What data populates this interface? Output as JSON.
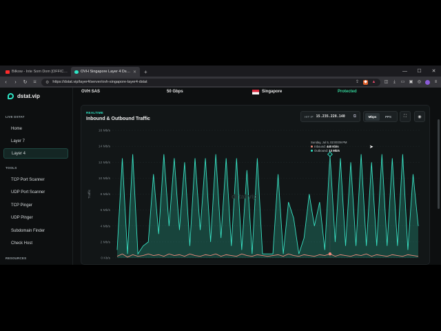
{
  "browser": {
    "tabs": [
      {
        "title": "Bilkow - Inte Som Dom [OFFICIAL...",
        "active": false,
        "favicon_color": "#ff2b2b"
      },
      {
        "title": "OVH Singapore Layer 4 Dstat Gr...",
        "active": true,
        "favicon_color": "#2ee6c6"
      }
    ],
    "new_tab": "+",
    "url": "https://dstat.vip/layer4/server/ovh-singapore-layer4-dstat"
  },
  "sidebar": {
    "logo": "dstat.vip",
    "sections": [
      {
        "title": "LIVE DSTAT",
        "items": [
          "Home",
          "Layer 7",
          "Layer 4"
        ]
      },
      {
        "title": "TOOLS",
        "items": [
          "TCP Port Scanner",
          "UDP Port Scanner",
          "TCP Pinger",
          "UDP Pinger",
          "Subdomain Finder",
          "Check Host"
        ]
      },
      {
        "title": "RESOURCES",
        "items": []
      }
    ],
    "active_item": "Layer 4"
  },
  "info": {
    "provider": "OVH SAS",
    "capacity": "50 Gbps",
    "location": "Singapore",
    "status": "Protected"
  },
  "card": {
    "eyebrow": "REALTIME",
    "title": "Inbound & Outbound Traffic",
    "hit_ip_label": "HIT IP",
    "hit_ip": "15.235.228.140",
    "toggle": [
      "Mbps",
      "PPS"
    ],
    "active_toggle": "Mbps",
    "watermark": "dstat.vip"
  },
  "tooltip": {
    "time": "Sunday, Jul 5, 02:00:09 PM",
    "inbound_label": "Inbound:",
    "inbound_value": "440 Kb/s",
    "outbound_label": "Outbound:",
    "outbound_value": "13 Mb/s"
  },
  "colors": {
    "accent": "#2ee6c6",
    "inbound": "#f08a7c",
    "background": "#0d0f10"
  },
  "chart_data": {
    "type": "area",
    "ylabel": "Traffic",
    "yticks": [
      "0 Kb/s",
      "2 Mb/s",
      "4 Mb/s",
      "6 Mb/s",
      "8 Mb/s",
      "10 Mb/s",
      "12 Mb/s",
      "14 Mb/s",
      "16 Mb/s"
    ],
    "ylim": [
      0,
      16
    ],
    "grid": true,
    "series": [
      {
        "name": "Outbound",
        "values": [
          1,
          12.5,
          0.5,
          13,
          0.5,
          1.5,
          2,
          10.5,
          3,
          13,
          4,
          12.5,
          3.5,
          12,
          1.5,
          12.5,
          3.5,
          12.5,
          2,
          13,
          2.5,
          12.5,
          1.5,
          12.5,
          1,
          11,
          0.5,
          12.5,
          0.5,
          0.5,
          0.5,
          10.5,
          0.5,
          7,
          5,
          0.5,
          2.5,
          8,
          4,
          7,
          1,
          13,
          2,
          12.5,
          1.5,
          12,
          1.5,
          13,
          1.5,
          12,
          1.5,
          13,
          1.5,
          12.5,
          1.5,
          13,
          1,
          10.5,
          4
        ]
      },
      {
        "name": "Inbound",
        "values": [
          0.2,
          0.5,
          0.1,
          0.4,
          0.2,
          0.3,
          0.5,
          0.3,
          0.4,
          0.2,
          0.5,
          0.3,
          0.4,
          0.2,
          0.5,
          0.3,
          0.2,
          0.4,
          0.3,
          0.5,
          0.2,
          0.4,
          0.3,
          0.2,
          0.5,
          0.3,
          0.2,
          0.4,
          0.3,
          0.2,
          0.3,
          0.4,
          0.2,
          0.5,
          0.3,
          0.2,
          0.4,
          0.3,
          0.2,
          0.4,
          0.3,
          0.5,
          0.2,
          0.4,
          0.3,
          0.2,
          0.4,
          0.3,
          0.5,
          0.2,
          0.4,
          0.3,
          0.2,
          0.4,
          0.3,
          0.2,
          0.4,
          0.3,
          0.2
        ]
      }
    ]
  }
}
